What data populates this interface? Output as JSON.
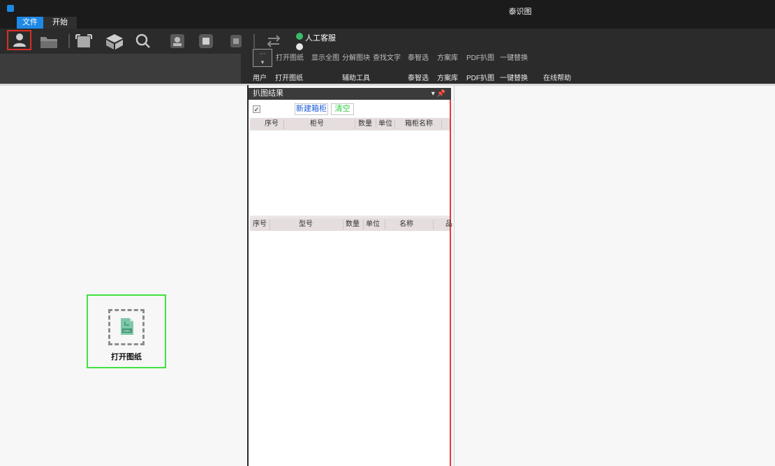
{
  "window": {
    "title": "泰识图"
  },
  "menu": {
    "tabs": [
      "文件",
      "开始"
    ]
  },
  "ribbon": {
    "service_label": "人工客服",
    "tools": [
      "打开图纸",
      "显示全图",
      "分解图块",
      "查找文字",
      "泰智选",
      "方案库",
      "PDF扒图",
      "一键替换"
    ],
    "groups": [
      "用户",
      "打开图纸",
      "辅助工具",
      "泰智选",
      "方案库",
      "PDF扒图",
      "一键替换",
      "在线帮助"
    ]
  },
  "left_canvas": {
    "open_label": "打开图纸"
  },
  "panel": {
    "title": "扒图结果",
    "new_cabinet_label": "新建箱柜",
    "clear_label": "清空",
    "table1_headers": [
      "序号",
      "柜号",
      "数量",
      "单位",
      "箱柜名称"
    ],
    "table2_headers": [
      "序号",
      "型号",
      "数量",
      "单位",
      "名称",
      "品"
    ]
  },
  "colors": {
    "accent": "#1e88e5",
    "highlight_border": "#3fe33f",
    "panel_border": "#e03a3a",
    "clear_green": "#2ecc40"
  }
}
